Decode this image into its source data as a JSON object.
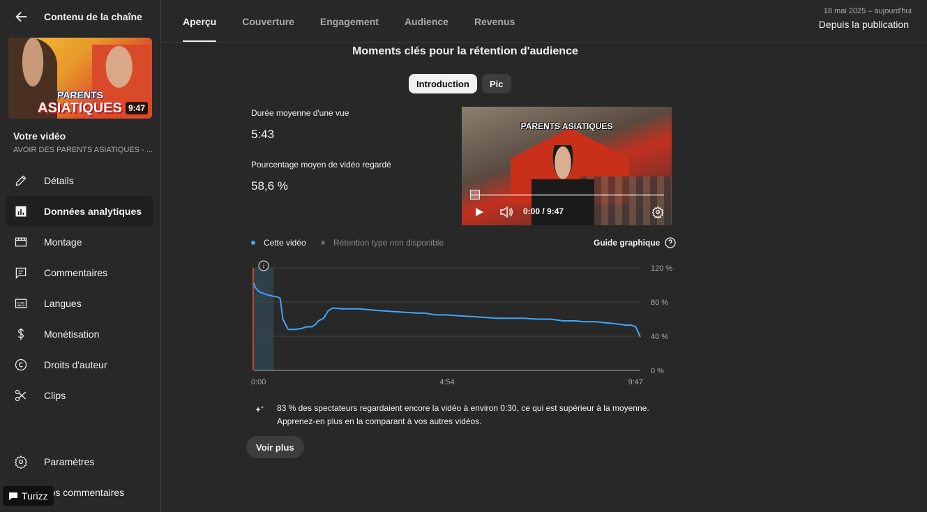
{
  "sidebar": {
    "title": "Contenu de la chaîne",
    "thumbnail": {
      "line1": "PARENTS",
      "line2": "ASIATIQUES",
      "duration": "9:47"
    },
    "your_video": "Votre vidéo",
    "video_title": "AVOIR DES PARENTS ASIATIQUES - ...",
    "items": [
      {
        "label": "Détails",
        "icon": "pencil-icon"
      },
      {
        "label": "Données analytiques",
        "icon": "analytics-icon",
        "active": true
      },
      {
        "label": "Montage",
        "icon": "editor-icon"
      },
      {
        "label": "Commentaires",
        "icon": "comments-icon"
      },
      {
        "label": "Langues",
        "icon": "subtitles-icon"
      },
      {
        "label": "Monétisation",
        "icon": "dollar-icon"
      },
      {
        "label": "Droits d'auteur",
        "icon": "copyright-icon"
      },
      {
        "label": "Clips",
        "icon": "scissors-icon"
      }
    ],
    "bottom_items": [
      {
        "label": "Paramètres",
        "icon": "gear-icon"
      },
      {
        "label": "Vos commentaires",
        "icon": "feedback-icon"
      }
    ]
  },
  "overlay": {
    "turizz": "Turizz"
  },
  "header": {
    "tabs": [
      "Aperçu",
      "Couverture",
      "Engagement",
      "Audience",
      "Revenus"
    ],
    "date_range": "18 mai 2025 – aujourd'hui",
    "period": "Depuis la publication"
  },
  "retention": {
    "title": "Moments clés pour la rétention d'audience",
    "pills": [
      "Introduction",
      "Pic"
    ],
    "avg_view_label": "Durée moyenne d'une vue",
    "avg_view_value": "5:43",
    "avg_pct_label": "Pourcentage moyen de vidéo regardé",
    "avg_pct_value": "58,6 %",
    "player": {
      "title": "PARENTS ASIATIQUES",
      "time": "0:00 / 9:47"
    },
    "legend": {
      "this_video": "Cette vidéo",
      "typical": "Rétention type non disponible"
    },
    "guide": "Guide graphique",
    "insight_line1": "83 % des spectateurs regardaient encore la vidéo à environ 0:30, ce qui est supérieur à la moyenne.",
    "insight_line2": "Apprenez-en plus en la comparant à vos autres vidéos.",
    "more_button": "Voir plus"
  },
  "colors": {
    "accent": "#3ea6ff",
    "background": "#282828",
    "highlight": "#e35a3a"
  },
  "chart_data": {
    "type": "line",
    "x_tick_labels": [
      "0:00",
      "4:54",
      "9:47"
    ],
    "y_tick_labels": [
      "120 %",
      "80 %",
      "40 %",
      "0 %"
    ],
    "xlim": [
      0,
      587
    ],
    "ylim": [
      0,
      120
    ],
    "highlight_range": [
      0,
      30
    ],
    "series": [
      {
        "name": "Cette vidéo",
        "x": [
          0,
          2,
          8,
          18,
          28,
          36,
          40,
          44,
          52,
          62,
          72,
          80,
          88,
          94,
          98,
          106,
          113,
          120,
          135,
          150,
          160,
          175,
          190,
          210,
          230,
          250,
          260,
          275,
          290,
          310,
          330,
          350,
          370,
          390,
          410,
          430,
          440,
          450,
          470,
          480,
          490,
          500,
          510,
          520,
          530,
          545,
          555,
          565,
          573,
          580,
          587
        ],
        "y": [
          102,
          97,
          92,
          89,
          87,
          86,
          84,
          60,
          48,
          48,
          49,
          51,
          51,
          54,
          58,
          61,
          70,
          73,
          72,
          72,
          72,
          71,
          70,
          69,
          68,
          67,
          67,
          65,
          65,
          64,
          63,
          62,
          61,
          61,
          61,
          60,
          60,
          60,
          58,
          58,
          58,
          57,
          57,
          57,
          56,
          55,
          54,
          53,
          53,
          51,
          39
        ]
      }
    ],
    "grid": true
  }
}
